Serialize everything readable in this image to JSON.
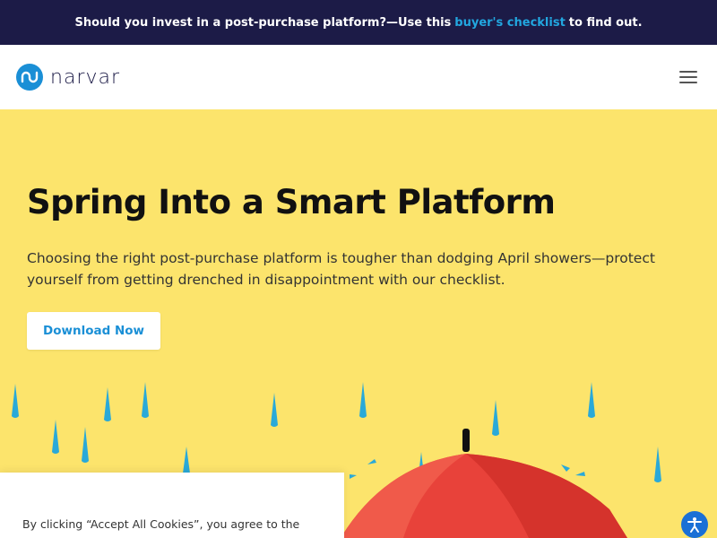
{
  "announcement": {
    "text_before": "Should you invest in a post-purchase platform?—Use this",
    "link_text": "buyer's checklist",
    "text_after": "to find out."
  },
  "header": {
    "logo_text": "narvar",
    "menu_icon": "hamburger-menu-icon"
  },
  "hero": {
    "title": "Spring Into a Smart Platform",
    "description": "Choosing the right post-purchase platform is tougher than dodging April showers—protect yourself from getting drenched in disappointment with our checklist.",
    "cta_label": "Download Now"
  },
  "cookie_banner": {
    "text": "By clicking “Accept All Cookies”, you agree to the"
  },
  "accessibility": {
    "icon": "accessibility-icon"
  },
  "colors": {
    "announcement_bg": "#1c1b47",
    "link": "#22a7e0",
    "hero_bg": "#fce46c",
    "brand_blue": "#1a8fd6",
    "umbrella_red": "#e8423a"
  }
}
